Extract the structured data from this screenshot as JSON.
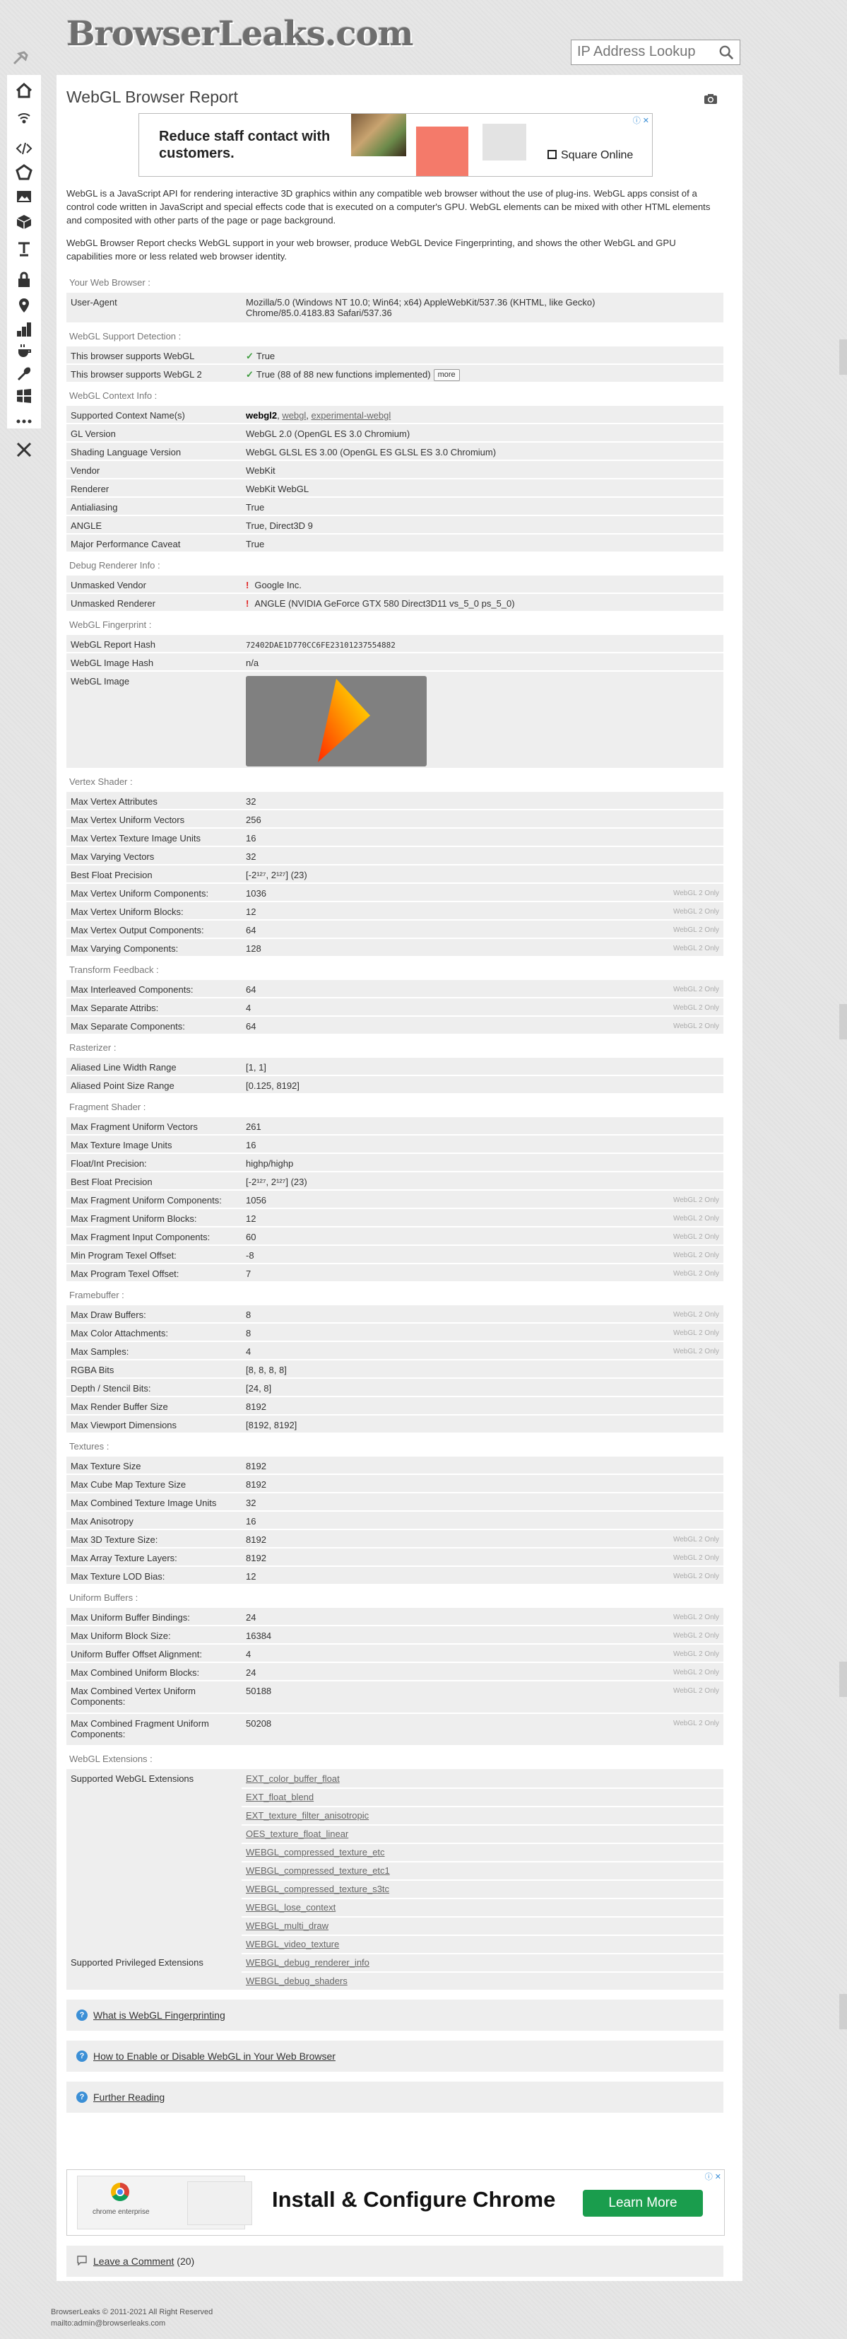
{
  "header": {
    "logo": "BrowserLeaks.com",
    "search_placeholder": "IP Address Lookup"
  },
  "rail_icons": [
    "home-icon",
    "wifi-icon",
    "code-icon",
    "pentagon-icon",
    "image-icon",
    "cube-icon",
    "text-icon",
    "lock-icon",
    "location-icon",
    "bars-icon",
    "cookie-icon",
    "wrench-icon",
    "windows-icon",
    "more-icon",
    "tools-icon"
  ],
  "page": {
    "title": "WebGL Browser Report",
    "intro1": "WebGL is a JavaScript API for rendering interactive 3D graphics within any compatible web browser without the use of plug-ins. WebGL apps consist of a control code written in JavaScript and special effects code that is executed on a computer's GPU. WebGL elements can be mixed with other HTML elements and composited with other parts of the page or page background.",
    "intro2": "WebGL Browser Report checks WebGL support in your web browser, produce WebGL Device Fingerprinting, and shows the other WebGL and GPU capabilities more or less related web browser identity."
  },
  "ad_top": {
    "headline": "Reduce staff contact with customers.",
    "brand": "Square Online",
    "adchoices": "ⓘ ✕"
  },
  "labels": {
    "webgl2_only": "WebGL 2 Only",
    "more": "more",
    "ok_mark": "✓",
    "warn_mark": "!"
  },
  "sections": {
    "browser": "Your Web Browser :",
    "support": "WebGL Support Detection :",
    "context": "WebGL Context Info :",
    "debug": "Debug Renderer Info :",
    "fingerprint": "WebGL Fingerprint :",
    "vertex": "Vertex Shader :",
    "transform": "Transform Feedback :",
    "raster": "Rasterizer :",
    "fragment": "Fragment Shader :",
    "framebuffer": "Framebuffer :",
    "textures": "Textures :",
    "uniform": "Uniform Buffers :",
    "extensions": "WebGL Extensions :"
  },
  "browser": {
    "ua_label": "User-Agent",
    "ua_line1": "Mozilla/5.0 (Windows NT 10.0; Win64; x64) AppleWebKit/537.36 (KHTML, like Gecko)",
    "ua_line2": "Chrome/85.0.4183.83 Safari/537.36"
  },
  "support": {
    "webgl_label": "This browser supports WebGL",
    "webgl_value": "True",
    "webgl2_label": "This browser supports WebGL 2",
    "webgl2_value": "True (88 of 88 new functions implemented)"
  },
  "context": {
    "names_label": "Supported Context Name(s)",
    "name1": "webgl2",
    "name2": "webgl",
    "name3": "experimental-webgl",
    "rows": [
      {
        "k": "GL Version",
        "v": "WebGL 2.0 (OpenGL ES 3.0 Chromium)"
      },
      {
        "k": "Shading Language Version",
        "v": "WebGL GLSL ES 3.00 (OpenGL ES GLSL ES 3.0 Chromium)"
      },
      {
        "k": "Vendor",
        "v": "WebKit"
      },
      {
        "k": "Renderer",
        "v": "WebKit WebGL"
      },
      {
        "k": "Antialiasing",
        "v": "True"
      },
      {
        "k": "ANGLE",
        "v": "True, Direct3D 9"
      },
      {
        "k": "Major Performance Caveat",
        "v": "True"
      }
    ]
  },
  "debug": {
    "vendor_label": "Unmasked Vendor",
    "vendor_value": "Google Inc.",
    "renderer_label": "Unmasked Renderer",
    "renderer_value": "ANGLE (NVIDIA GeForce GTX 580 Direct3D11 vs_5_0 ps_5_0)"
  },
  "fingerprint": {
    "hash_label": "WebGL Report Hash",
    "hash_value": "72402DAE1D770CC6FE23101237554882",
    "image_hash_label": "WebGL Image Hash",
    "image_hash_value": "n/a",
    "image_label": "WebGL Image"
  },
  "vertex": [
    {
      "k": "Max Vertex Attributes",
      "v": "32"
    },
    {
      "k": "Max Vertex Uniform Vectors",
      "v": "256"
    },
    {
      "k": "Max Vertex Texture Image Units",
      "v": "16"
    },
    {
      "k": "Max Varying Vectors",
      "v": "32"
    },
    {
      "k": "Best Float Precision",
      "v": "[-2¹²⁷, 2¹²⁷] (23)"
    },
    {
      "k": "Max Vertex Uniform Components:",
      "v": "1036",
      "n": true
    },
    {
      "k": "Max Vertex Uniform Blocks:",
      "v": "12",
      "n": true
    },
    {
      "k": "Max Vertex Output Components:",
      "v": "64",
      "n": true
    },
    {
      "k": "Max Varying Components:",
      "v": "128",
      "n": true
    }
  ],
  "transform": [
    {
      "k": "Max Interleaved Components:",
      "v": "64",
      "n": true
    },
    {
      "k": "Max Separate Attribs:",
      "v": "4",
      "n": true
    },
    {
      "k": "Max Separate Components:",
      "v": "64",
      "n": true
    }
  ],
  "raster": [
    {
      "k": "Aliased Line Width Range",
      "v": "[1, 1]"
    },
    {
      "k": "Aliased Point Size Range",
      "v": "[0.125, 8192]"
    }
  ],
  "fragment": [
    {
      "k": "Max Fragment Uniform Vectors",
      "v": "261"
    },
    {
      "k": "Max Texture Image Units",
      "v": "16"
    },
    {
      "k": "Float/Int Precision:",
      "v": "highp/highp"
    },
    {
      "k": "Best Float Precision",
      "v": "[-2¹²⁷, 2¹²⁷] (23)"
    },
    {
      "k": "Max Fragment Uniform Components:",
      "v": "1056",
      "n": true
    },
    {
      "k": "Max Fragment Uniform Blocks:",
      "v": "12",
      "n": true
    },
    {
      "k": "Max Fragment Input Components:",
      "v": "60",
      "n": true
    },
    {
      "k": "Min Program Texel Offset:",
      "v": "-8",
      "n": true
    },
    {
      "k": "Max Program Texel Offset:",
      "v": "7",
      "n": true
    }
  ],
  "framebuffer": [
    {
      "k": "Max Draw Buffers:",
      "v": "8",
      "n": true
    },
    {
      "k": "Max Color Attachments:",
      "v": "8",
      "n": true
    },
    {
      "k": "Max Samples:",
      "v": "4",
      "n": true
    },
    {
      "k": "RGBA Bits",
      "v": "[8, 8, 8, 8]"
    },
    {
      "k": "Depth / Stencil Bits:",
      "v": "[24, 8]"
    },
    {
      "k": "Max Render Buffer Size",
      "v": "8192"
    },
    {
      "k": "Max Viewport Dimensions",
      "v": "[8192, 8192]"
    }
  ],
  "textures": [
    {
      "k": "Max Texture Size",
      "v": "8192"
    },
    {
      "k": "Max Cube Map Texture Size",
      "v": "8192"
    },
    {
      "k": "Max Combined Texture Image Units",
      "v": "32"
    },
    {
      "k": "Max Anisotropy",
      "v": "16"
    },
    {
      "k": "Max 3D Texture Size:",
      "v": "8192",
      "n": true
    },
    {
      "k": "Max Array Texture Layers:",
      "v": "8192",
      "n": true
    },
    {
      "k": "Max Texture LOD Bias:",
      "v": "12",
      "n": true
    }
  ],
  "uniform": [
    {
      "k": "Max Uniform Buffer Bindings:",
      "v": "24",
      "n": true
    },
    {
      "k": "Max Uniform Block Size:",
      "v": "16384",
      "n": true
    },
    {
      "k": "Uniform Buffer Offset Alignment:",
      "v": "4",
      "n": true
    },
    {
      "k": "Max Combined Uniform Blocks:",
      "v": "24",
      "n": true
    },
    {
      "k": "Max Combined Vertex Uniform Components:",
      "v": "50188",
      "n": true
    },
    {
      "k": "Max Combined Fragment Uniform Components:",
      "v": "50208",
      "n": true
    }
  ],
  "extensions": {
    "supported_label": "Supported WebGL Extensions",
    "list": [
      "EXT_color_buffer_float",
      "EXT_float_blend",
      "EXT_texture_filter_anisotropic",
      "OES_texture_float_linear",
      "WEBGL_compressed_texture_etc",
      "WEBGL_compressed_texture_etc1",
      "WEBGL_compressed_texture_s3tc",
      "WEBGL_lose_context",
      "WEBGL_multi_draw",
      "WEBGL_video_texture"
    ],
    "privileged_label": "Supported Privileged Extensions",
    "privileged": [
      "WEBGL_debug_renderer_info",
      "WEBGL_debug_shaders"
    ]
  },
  "help_links": [
    "What is WebGL Fingerprinting",
    "How to Enable or Disable WebGL in Your Web Browser",
    "Further Reading"
  ],
  "ad_bottom": {
    "enterprise": "chrome enterprise",
    "headline": "Install & Configure Chrome",
    "cta": "Learn More",
    "adchoices": "ⓘ ✕"
  },
  "comment": {
    "label": "Leave a Comment",
    "count": "(20)"
  },
  "footer": {
    "copyright": "BrowserLeaks © 2011-2021 All Right Reserved",
    "mail": "mailto:admin@browserleaks.com"
  }
}
